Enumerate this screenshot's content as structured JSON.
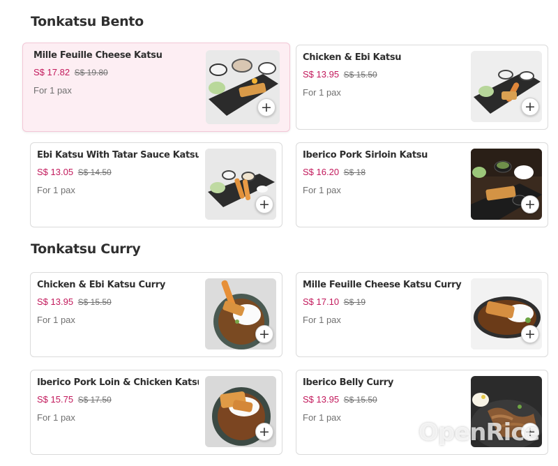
{
  "sections": [
    {
      "title": "Tonkatsu Bento",
      "items": [
        {
          "name": "Mille Feuille Cheese Katsu",
          "price": "S$ 17.82",
          "old_price": "S$ 19.80",
          "pax": "For 1 pax"
        },
        {
          "name": "Chicken & Ebi Katsu",
          "price": "S$ 13.95",
          "old_price": "S$ 15.50",
          "pax": "For 1 pax"
        },
        {
          "name": "Ebi Katsu With Tatar Sauce Katsu",
          "price": "S$ 13.05",
          "old_price": "S$ 14.50",
          "pax": "For 1 pax"
        },
        {
          "name": "Iberico Pork Sirloin Katsu",
          "price": "S$ 16.20",
          "old_price": "S$ 18",
          "pax": "For 1 pax"
        }
      ]
    },
    {
      "title": "Tonkatsu Curry",
      "items": [
        {
          "name": "Chicken & Ebi Katsu Curry",
          "price": "S$ 13.95",
          "old_price": "S$ 15.50",
          "pax": "For 1 pax"
        },
        {
          "name": "Mille Feuille Cheese Katsu Curry",
          "price": "S$ 17.10",
          "old_price": "S$ 19",
          "pax": "For 1 pax"
        },
        {
          "name": "Iberico Pork Loin & Chicken Katsu ...",
          "price": "S$ 15.75",
          "old_price": "S$ 17.50",
          "pax": "For 1 pax"
        },
        {
          "name": "Iberico Belly Curry",
          "price": "S$ 13.95",
          "old_price": "S$ 15.50",
          "pax": "For 1 pax"
        }
      ]
    }
  ],
  "add_icon": "plus-icon",
  "watermark": "OpenRice",
  "colors": {
    "price": "#c2185b",
    "highlight_bg": "#fdeef3",
    "highlight_border": "#f3c7d6"
  }
}
